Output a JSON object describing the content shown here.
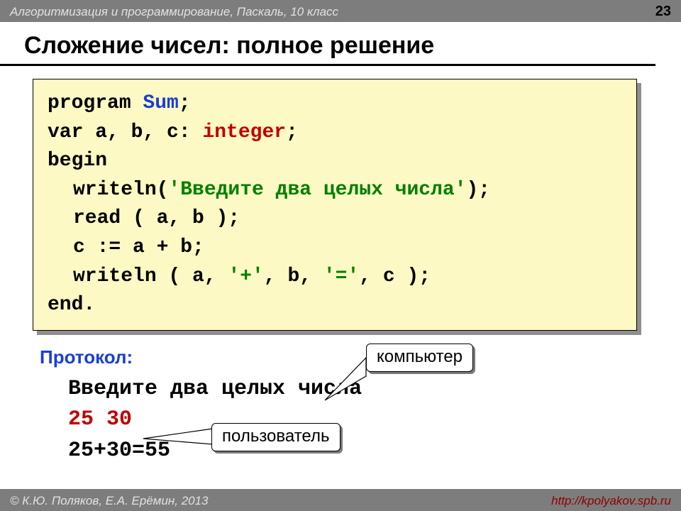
{
  "header": {
    "course": "Алгоритмизация и программирование, Паскаль, 10 класс",
    "page_number": "23"
  },
  "title": "Сложение чисел: полное решение",
  "code": {
    "l1_program": "program ",
    "l1_name": "Sum",
    "l1_semi": ";",
    "l2_var": "var a, b, c: ",
    "l2_type": "integer",
    "l2_semi": ";",
    "l3_begin": "begin",
    "l4_write": "writeln(",
    "l4_str": "'Введите два целых числа'",
    "l4_end": ");",
    "l5": "read ( a, b );",
    "l6": "c := a + b;",
    "l7_a": "writeln ( a, ",
    "l7_s1": "'+'",
    "l7_b": ", b, ",
    "l7_s2": "'='",
    "l7_c": ", c );",
    "l8_end": "end."
  },
  "protocol_label": "Протокол:",
  "protocol": {
    "line1": "Введите два целых числа",
    "line2": "25 30",
    "line3": "25+30=55"
  },
  "callouts": {
    "computer": "компьютер",
    "user": "пользователь"
  },
  "footer": {
    "copyright": "© К.Ю. Поляков, Е.А. Ерёмин, 2013",
    "url": "http://kpolyakov.spb.ru"
  }
}
